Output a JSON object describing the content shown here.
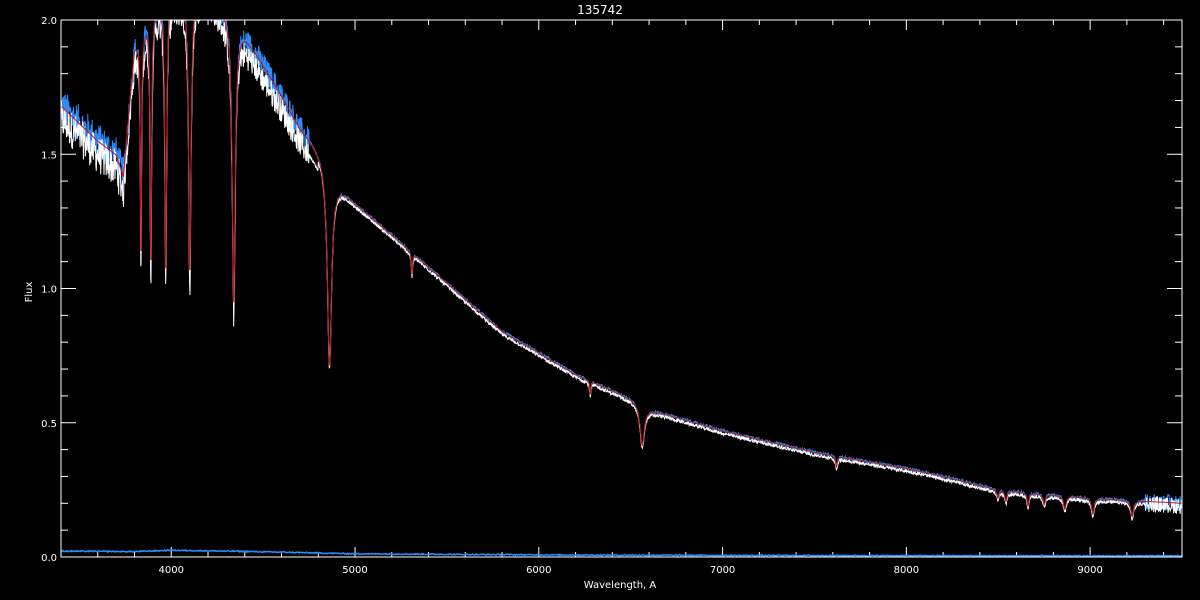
{
  "chart_data": {
    "type": "line",
    "title": "135742",
    "xlabel": "Wavelength, A",
    "ylabel": "Flux",
    "xlim": [
      3400,
      9500
    ],
    "ylim": [
      0.0,
      2.0
    ],
    "x_ticks": [
      4000,
      5000,
      6000,
      7000,
      8000,
      9000
    ],
    "y_ticks": [
      0.0,
      0.5,
      1.0,
      1.5,
      2.0
    ],
    "x_tick_labels": [
      "4000",
      "5000",
      "6000",
      "7000",
      "8000",
      "9000"
    ],
    "y_tick_labels": [
      "0.0",
      "0.5",
      "1.0",
      "1.5",
      "2.0"
    ],
    "grid": false,
    "legend": "none",
    "colors": {
      "background": "#000000",
      "axes": "#ffffff",
      "observed": "#ffffff",
      "model": "#c81414",
      "blue": "#2a8cff"
    },
    "continuum": {
      "x": [
        3400,
        3600,
        3700,
        3740,
        3800,
        3900,
        4000,
        4200,
        4400,
        4600,
        4700,
        4850,
        4900,
        5000,
        5200,
        5500,
        5800,
        6000,
        6200,
        6500,
        6600,
        7000,
        7500,
        8000,
        8200,
        8500,
        9000,
        9500
      ],
      "y": [
        1.68,
        1.55,
        1.5,
        1.42,
        1.9,
        2.05,
        2.1,
        2.12,
        1.95,
        1.72,
        1.6,
        1.48,
        1.4,
        1.32,
        1.2,
        1.02,
        0.84,
        0.76,
        0.68,
        0.59,
        0.55,
        0.47,
        0.39,
        0.33,
        0.3,
        0.25,
        0.22,
        0.2
      ]
    },
    "absorption_lines": [
      {
        "x": 3835,
        "depth": 0.85,
        "width": 4
      },
      {
        "x": 3889,
        "depth": 0.95,
        "width": 5
      },
      {
        "x": 3970,
        "depth": 1.0,
        "width": 6
      },
      {
        "x": 4101,
        "depth": 1.05,
        "width": 8
      },
      {
        "x": 4340,
        "depth": 1.05,
        "width": 10
      },
      {
        "x": 4861,
        "depth": 0.75,
        "width": 14
      },
      {
        "x": 5310,
        "depth": 0.08,
        "width": 4
      },
      {
        "x": 6280,
        "depth": 0.05,
        "width": 4
      },
      {
        "x": 6563,
        "depth": 0.15,
        "width": 14
      },
      {
        "x": 7620,
        "depth": 0.04,
        "width": 6
      },
      {
        "x": 8498,
        "depth": 0.03,
        "width": 6
      },
      {
        "x": 8542,
        "depth": 0.04,
        "width": 7
      },
      {
        "x": 8662,
        "depth": 0.05,
        "width": 7
      },
      {
        "x": 8750,
        "depth": 0.04,
        "width": 8
      },
      {
        "x": 8862,
        "depth": 0.05,
        "width": 9
      },
      {
        "x": 9015,
        "depth": 0.06,
        "width": 9
      },
      {
        "x": 9229,
        "depth": 0.06,
        "width": 10
      }
    ],
    "error_series": {
      "x": [
        3400,
        3800,
        4000,
        4200,
        4600,
        5000,
        6000,
        7000,
        8000,
        9000,
        9500
      ],
      "y": [
        0.022,
        0.02,
        0.025,
        0.023,
        0.018,
        0.012,
        0.008,
        0.006,
        0.005,
        0.004,
        0.004
      ]
    }
  }
}
